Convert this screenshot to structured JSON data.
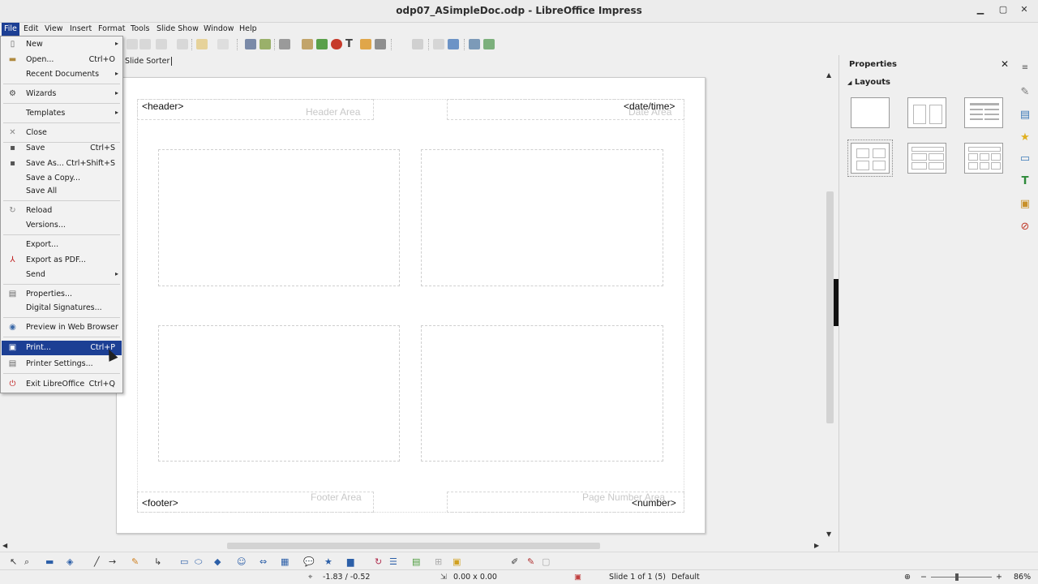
{
  "window": {
    "title": "odp07_ASimpleDoc.odp - LibreOffice Impress",
    "minimize": "▁",
    "maximize": "▢",
    "close": "✕"
  },
  "menubar": [
    "File",
    "Edit",
    "View",
    "Insert",
    "Format",
    "Tools",
    "Slide Show",
    "Window",
    "Help"
  ],
  "tabs": {
    "slide_sorter": "Slide Sorter"
  },
  "file_menu": [
    {
      "label": "New",
      "shortcut": "",
      "submenu": true,
      "icon": "new-doc-icon"
    },
    {
      "label": "Open...",
      "shortcut": "Ctrl+O",
      "submenu": false,
      "icon": "open-folder-icon"
    },
    {
      "label": "Recent Documents",
      "shortcut": "",
      "submenu": true,
      "icon": ""
    },
    {
      "label": "Wizards",
      "shortcut": "",
      "submenu": true,
      "icon": "wizard-icon"
    },
    {
      "label": "Templates",
      "shortcut": "",
      "submenu": true,
      "icon": ""
    },
    {
      "label": "Close",
      "shortcut": "",
      "submenu": false,
      "icon": "close-doc-icon"
    },
    {
      "label": "Save",
      "shortcut": "Ctrl+S",
      "submenu": false,
      "icon": "save-icon"
    },
    {
      "label": "Save As...",
      "shortcut": "Ctrl+Shift+S",
      "submenu": false,
      "icon": "save-as-icon"
    },
    {
      "label": "Save a Copy...",
      "shortcut": "",
      "submenu": false,
      "icon": ""
    },
    {
      "label": "Save All",
      "shortcut": "",
      "submenu": false,
      "icon": ""
    },
    {
      "label": "Reload",
      "shortcut": "",
      "submenu": false,
      "icon": "reload-icon"
    },
    {
      "label": "Versions...",
      "shortcut": "",
      "submenu": false,
      "icon": ""
    },
    {
      "label": "Export...",
      "shortcut": "",
      "submenu": false,
      "icon": ""
    },
    {
      "label": "Export as PDF...",
      "shortcut": "",
      "submenu": false,
      "icon": "pdf-icon"
    },
    {
      "label": "Send",
      "shortcut": "",
      "submenu": true,
      "icon": ""
    },
    {
      "label": "Properties...",
      "shortcut": "",
      "submenu": false,
      "icon": "properties-icon"
    },
    {
      "label": "Digital Signatures...",
      "shortcut": "",
      "submenu": false,
      "icon": ""
    },
    {
      "label": "Preview in Web Browser",
      "shortcut": "",
      "submenu": false,
      "icon": "web-preview-icon"
    },
    {
      "label": "Print...",
      "shortcut": "Ctrl+P",
      "submenu": false,
      "icon": "print-icon"
    },
    {
      "label": "Printer Settings...",
      "shortcut": "",
      "submenu": false,
      "icon": "printer-settings-icon"
    },
    {
      "label": "Exit LibreOffice",
      "shortcut": "Ctrl+Q",
      "submenu": false,
      "icon": "exit-icon"
    }
  ],
  "slide": {
    "header_field": "<header>",
    "header_area": "Header Area",
    "datetime_field": "<date/time>",
    "date_area": "Date Area",
    "footer_field": "<footer>",
    "footer_area": "Footer Area",
    "number_field": "<number>",
    "page_number_area": "Page Number Area"
  },
  "sidebar": {
    "title": "Properties",
    "close": "✕",
    "section": "Layouts",
    "section_arrow": "◢"
  },
  "status": {
    "position": "-1.83 / -0.52",
    "size": "0.00 x 0.00",
    "slide": "Slide 1 of 1 (5)",
    "master": "Default",
    "zoom": "86%",
    "zoom_minus": "−",
    "zoom_plus": "+"
  },
  "colors": {
    "menu_highlight": "#1c3f94",
    "placeholder_text": "#c8c8c8"
  }
}
